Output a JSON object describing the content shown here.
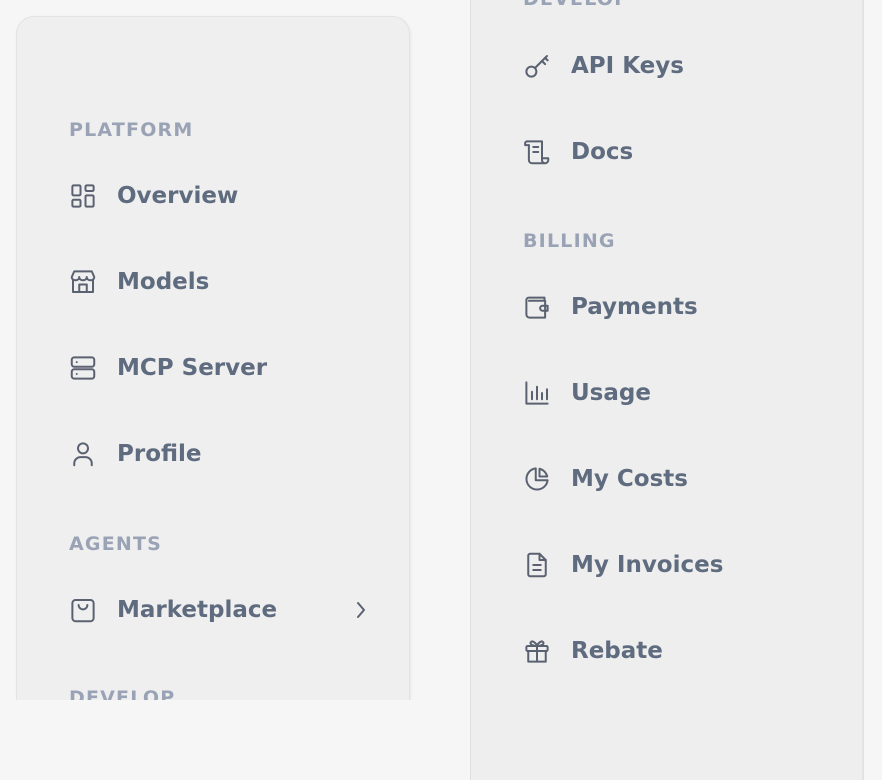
{
  "left": {
    "sections": {
      "platform": "PLATFORM",
      "agents": "AGENTS",
      "develop": "DEVELOP"
    },
    "items": {
      "overview": {
        "label": "Overview",
        "icon": "dashboard-grid-icon"
      },
      "models": {
        "label": "Models",
        "icon": "storefront-icon"
      },
      "mcp_server": {
        "label": "MCP Server",
        "icon": "server-icon"
      },
      "profile": {
        "label": "Profile",
        "icon": "user-icon"
      },
      "marketplace": {
        "label": "Marketplace",
        "icon": "shopping-bag-icon"
      }
    }
  },
  "right": {
    "sections": {
      "develop": "DEVELOP",
      "billing": "BILLING"
    },
    "items": {
      "api_keys": {
        "label": "API Keys",
        "icon": "key-icon"
      },
      "docs": {
        "label": "Docs",
        "icon": "scroll-icon"
      },
      "payments": {
        "label": "Payments",
        "icon": "wallet-icon"
      },
      "usage": {
        "label": "Usage",
        "icon": "bar-chart-icon"
      },
      "my_costs": {
        "label": "My Costs",
        "icon": "pie-chart-icon"
      },
      "my_invoices": {
        "label": "My Invoices",
        "icon": "document-icon"
      },
      "rebate": {
        "label": "Rebate",
        "icon": "gift-icon"
      }
    }
  },
  "colors": {
    "label_text": "#5f6b7e",
    "section_text": "#9aa3b5",
    "icon_stroke": "#5a6170",
    "panel_bg": "#efefef",
    "page_bg": "#f6f6f6"
  }
}
